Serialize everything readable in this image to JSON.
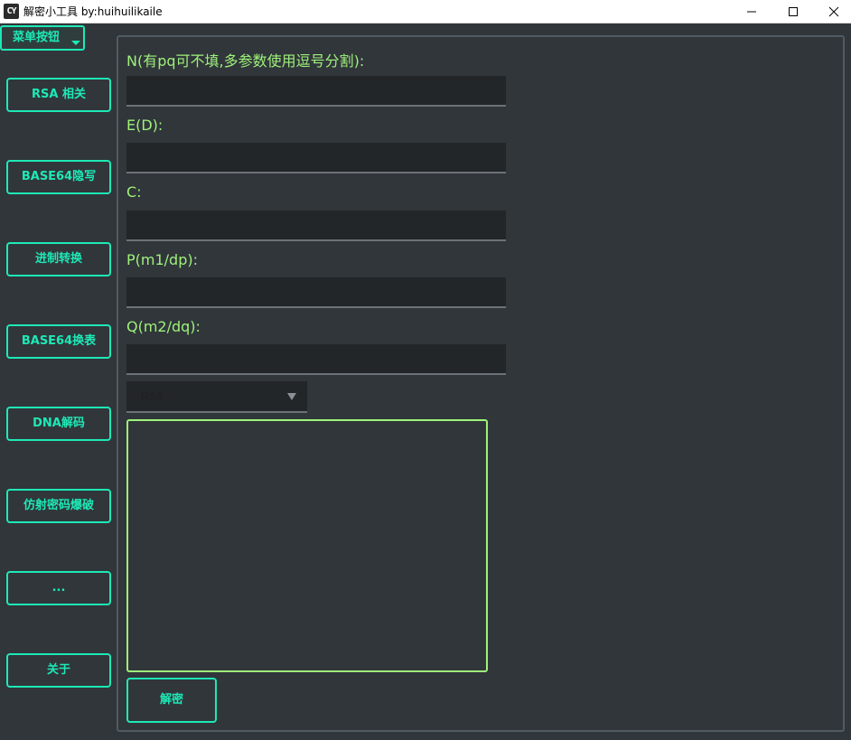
{
  "window": {
    "icon_text": "CY",
    "title": "解密小工具 by:huihuilikaile"
  },
  "menu": {
    "label": "菜单按钮"
  },
  "sidebar": {
    "items": [
      {
        "label": "RSA 相关"
      },
      {
        "label": "BASE64隐写"
      },
      {
        "label": "进制转换"
      },
      {
        "label": "BASE64换表"
      },
      {
        "label": "DNA解码"
      },
      {
        "label": "仿射密码爆破"
      },
      {
        "label": "..."
      },
      {
        "label": "关于"
      }
    ]
  },
  "form": {
    "fields": [
      {
        "label": "N(有pq可不填,多参数使用逗号分割):",
        "value": ""
      },
      {
        "label": "E(D):",
        "value": ""
      },
      {
        "label": "C:",
        "value": ""
      },
      {
        "label": "P(m1/dp):",
        "value": ""
      },
      {
        "label": "Q(m2/dq):",
        "value": ""
      }
    ],
    "algorithm": {
      "selected": "RSA"
    },
    "output": "",
    "decrypt_label": "解密"
  },
  "colors": {
    "background": "#31363b",
    "accent": "#1de9b6",
    "label": "#9ef27a",
    "input_bg": "#232629"
  }
}
